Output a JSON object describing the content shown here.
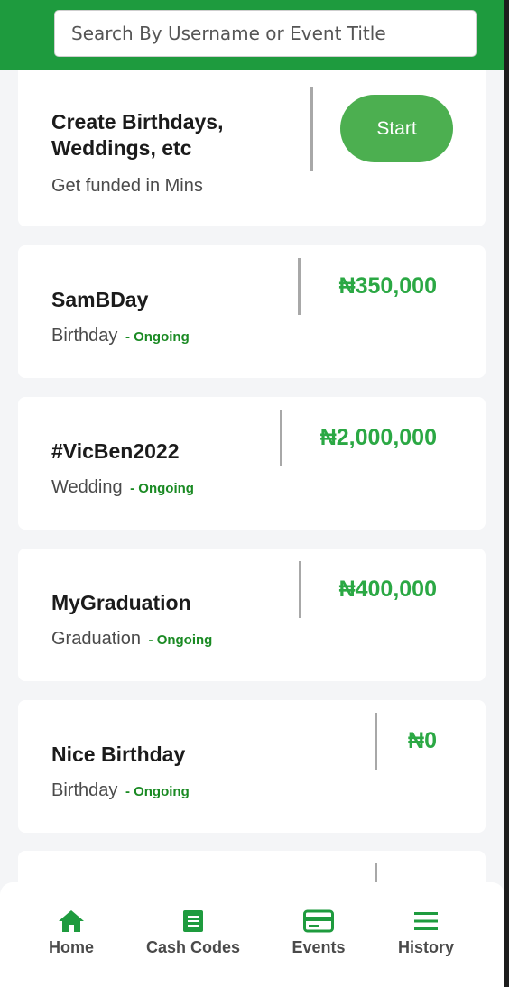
{
  "search": {
    "placeholder": "Search By Username or Event Title"
  },
  "promo": {
    "title": "Create Birthdays, Weddings, etc",
    "subtitle": "Get funded in Mins",
    "start_label": "Start"
  },
  "events": [
    {
      "title": "SamBDay",
      "type": "Birthday",
      "status": "- Ongoing",
      "amount": "₦350,000"
    },
    {
      "title": "#VicBen2022",
      "type": "Wedding",
      "status": "- Ongoing",
      "amount": "₦2,000,000"
    },
    {
      "title": "MyGraduation",
      "type": "Graduation",
      "status": "- Ongoing",
      "amount": "₦400,000"
    },
    {
      "title": "Nice Birthday",
      "type": "Birthday",
      "status": "- Ongoing",
      "amount": "₦0"
    }
  ],
  "nav": [
    {
      "label": "Home",
      "icon": "home-icon"
    },
    {
      "label": "Cash Codes",
      "icon": "document-icon"
    },
    {
      "label": "Events",
      "icon": "card-icon"
    },
    {
      "label": "History",
      "icon": "menu-icon"
    }
  ],
  "colors": {
    "header": "#1e9b3e",
    "accent": "#4caf50",
    "amount": "#2ba844",
    "status": "#1a8a23",
    "icon": "#1e9b3e"
  }
}
